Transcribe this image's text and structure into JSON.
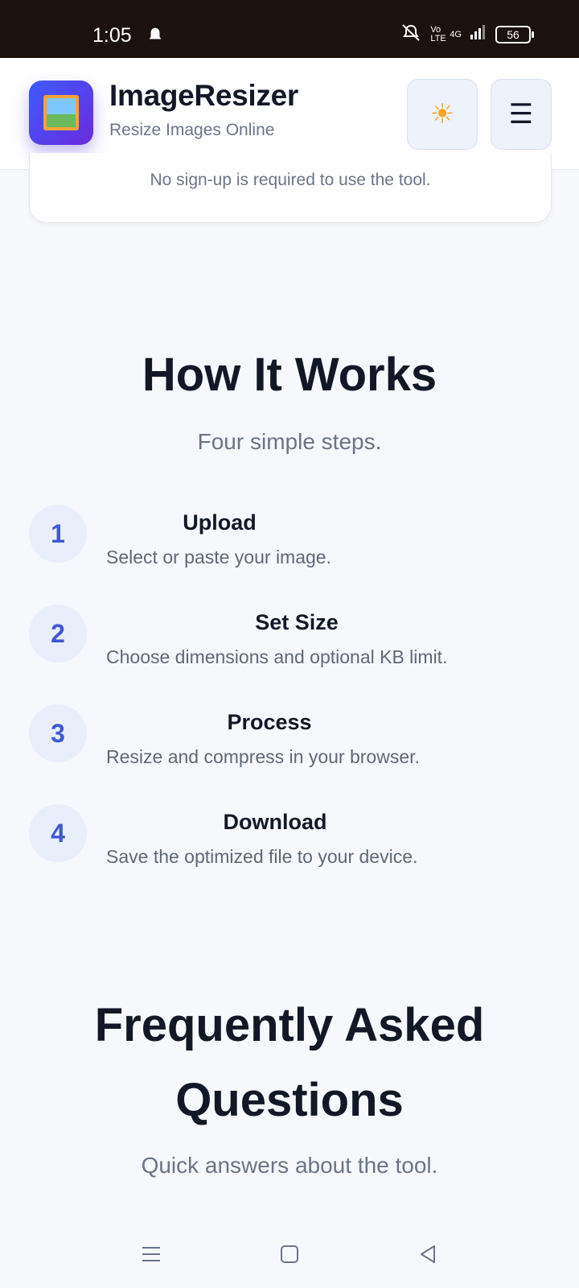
{
  "status_bar": {
    "time": "1:05",
    "volte": "Vo LTE",
    "network": "4G",
    "battery": "56"
  },
  "header": {
    "app_name": "ImageResizer",
    "tagline": "Resize Images Online",
    "theme_icon": "sun-icon",
    "menu_icon": "hamburger-icon"
  },
  "info_card": {
    "text": "No sign-up is required to use the tool."
  },
  "how_it_works": {
    "title": "How It Works",
    "subtitle": "Four simple steps.",
    "steps": [
      {
        "num": "1",
        "title": "Upload",
        "desc": "Select or paste your image."
      },
      {
        "num": "2",
        "title": "Set Size",
        "desc": "Choose dimensions and optional KB limit."
      },
      {
        "num": "3",
        "title": "Process",
        "desc": "Resize and compress in your browser."
      },
      {
        "num": "4",
        "title": "Download",
        "desc": "Save the optimized file to your device."
      }
    ]
  },
  "faq": {
    "title_line1": "Frequently Asked",
    "title_line2": "Questions",
    "subtitle": "Quick answers about the tool."
  },
  "colors": {
    "accent": "#3d59d6",
    "logo_gradient_start": "#3d5bff",
    "logo_gradient_end": "#6a2bdc"
  }
}
